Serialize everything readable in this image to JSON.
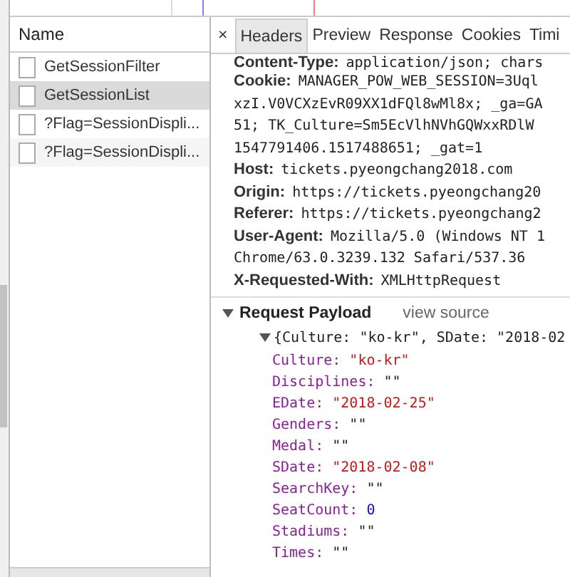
{
  "requests_panel": {
    "column": "Name",
    "items": [
      {
        "name": "GetSessionFilter",
        "selected": false
      },
      {
        "name": "GetSessionList",
        "selected": true
      },
      {
        "name": "?Flag=SessionDispli...",
        "selected": false
      },
      {
        "name": "?Flag=SessionDispli...",
        "selected": false
      }
    ]
  },
  "detail": {
    "close": "×",
    "tabs": [
      {
        "label": "Headers",
        "selected": true
      },
      {
        "label": "Preview",
        "selected": false
      },
      {
        "label": "Response",
        "selected": false
      },
      {
        "label": "Cookies",
        "selected": false
      },
      {
        "label": "Timi",
        "selected": false
      }
    ],
    "headers": [
      {
        "name": "Content-Type:",
        "value": "application/json; chars"
      },
      {
        "name": "Cookie:",
        "value": "MANAGER_POW_WEB_SESSION=3Uql",
        "more": [
          "xzI.V0VCXzEvR09XX1dFQl8wMl8x; _ga=GA",
          "51; TK_Culture=Sm5EcVlhNVhGQWxxRDlW",
          "1547791406.1517488651; _gat=1"
        ]
      },
      {
        "name": "Host:",
        "value": "tickets.pyeongchang2018.com"
      },
      {
        "name": "Origin:",
        "value": "https://tickets.pyeongchang20"
      },
      {
        "name": "Referer:",
        "value": "https://tickets.pyeongchang2"
      },
      {
        "name": "User-Agent:",
        "value": "Mozilla/5.0 (Windows NT 1",
        "more": [
          "Chrome/63.0.3239.132 Safari/537.36"
        ]
      },
      {
        "name": "X-Requested-With:",
        "value": "XMLHttpRequest"
      }
    ],
    "payload": {
      "title": "Request Payload",
      "link": "view source",
      "expanded": true,
      "summary": "{Culture: \"ko-kr\", SDate: \"2018-02",
      "summary_expanded": true,
      "properties": [
        {
          "key": "Culture:",
          "value": "\"ko-kr\"",
          "kind": "string"
        },
        {
          "key": "Disciplines:",
          "value": "\"\"",
          "kind": "empty"
        },
        {
          "key": "EDate:",
          "value": "\"2018-02-25\"",
          "kind": "string"
        },
        {
          "key": "Genders:",
          "value": "\"\"",
          "kind": "empty"
        },
        {
          "key": "Medal:",
          "value": "\"\"",
          "kind": "empty"
        },
        {
          "key": "SDate:",
          "value": "\"2018-02-08\"",
          "kind": "string"
        },
        {
          "key": "SearchKey:",
          "value": "\"\"",
          "kind": "empty"
        },
        {
          "key": "SeatCount:",
          "value": "0",
          "kind": "number"
        },
        {
          "key": "Stadiums:",
          "value": "\"\"",
          "kind": "empty"
        },
        {
          "key": "Times:",
          "value": "\"\"",
          "kind": "empty"
        }
      ]
    }
  }
}
